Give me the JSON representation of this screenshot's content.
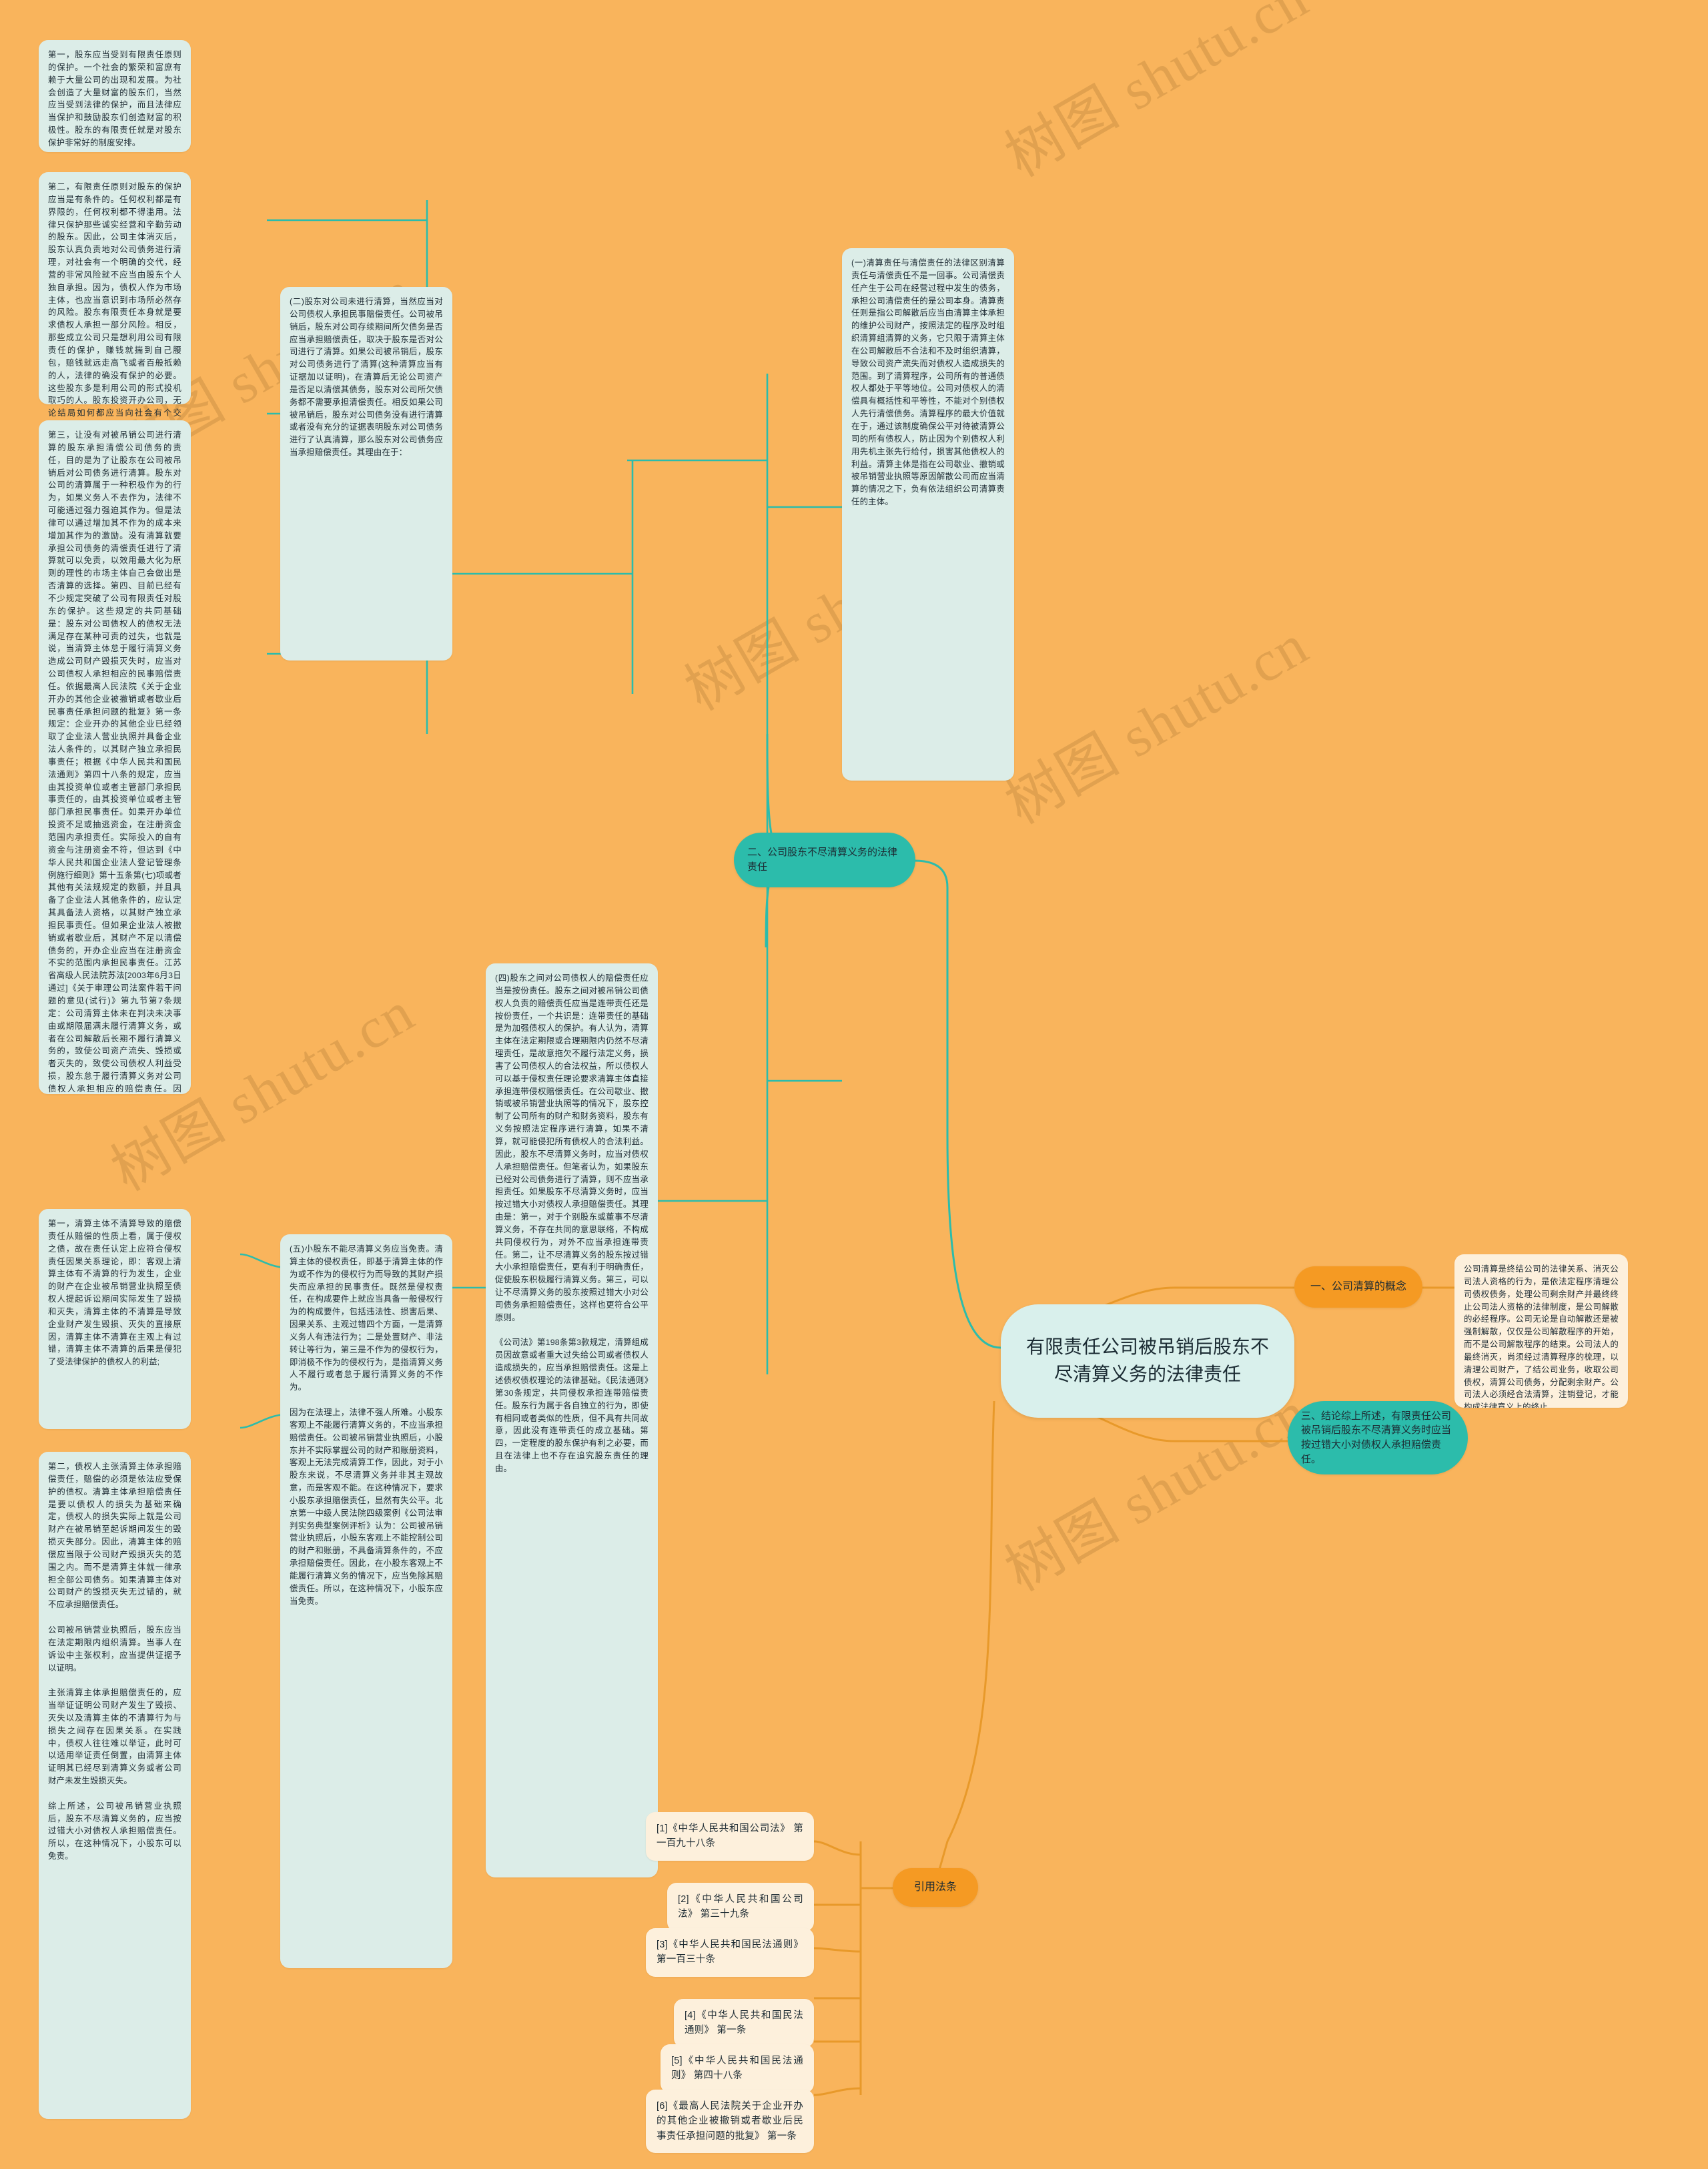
{
  "meta": {
    "background_color": "#F9B45C",
    "leaf_card_color": "#DCEDE8",
    "cream_card_color": "#FDF0DC",
    "teal_accent": "#2CBCAB",
    "orange_accent": "#F59A23",
    "root_color": "#D9F0EC"
  },
  "watermarks": [
    "树图 shutu.cn",
    "树图 shutu.cn",
    "树图 shutu.cn",
    "树图 shutu.cn",
    "树图 shutu.cn",
    "树图 shutu.cn"
  ],
  "root": {
    "title": "有限责任公司被吊销后股东不尽清算义务的法律责任"
  },
  "branches": {
    "concept": {
      "label": "一、公司清算的概念"
    },
    "liability": {
      "label": "二、公司股东不尽清算义务的法律责任"
    },
    "conclusion": {
      "label": "三、结论综上所述，有限责任公司被吊销后股东不尽清算义务时应当按过错大小对债权人承担赔偿责任。"
    },
    "references": {
      "label": "引用法条"
    }
  },
  "concept_detail": "公司清算是终结公司的法律关系、消灭公司法人资格的行为，是依法定程序清理公司债权债务，处理公司剩余财产并最终终止公司法人资格的法律制度，是公司解散的必经程序。公司无论是自动解散还是被强制解散，仅仅是公司解散程序的开始，而不是公司解散程序的结束。公司法人的最终消灭，尚须经过清算程序的梳理，以清理公司财产，了结公司业务，收取公司债权，清算公司债务，分配剩余财产。公司法人必须经合法清算，注销登记，才能构成法律意义上的终止。",
  "liability_sections": [
    {
      "id": "sec-yi",
      "text": "(一)清算责任与清偿责任的法律区别清算责任与清偿责任不是一回事。公司清偿责任产生于公司在经营过程中发生的债务，承担公司清偿责任的是公司本身。清算责任则是指公司解散后应当由清算主体承担的维护公司财产，按照法定的程序及时组织清算组清算的义务，它只限于清算主体在公司解散后不合法和不及时组织清算，导致公司资产流失而对债权人造成损失的范围。到了清算程序，公司所有的普通债权人都处于平等地位。公司对债权人的清偿具有概括性和平等性，不能对个别债权人先行清偿债务。清算程序的最大价值就在于，通过该制度确保公平对待被清算公司的所有债权人，防止因为个别债权人利用先机主张先行给付，损害其他债权人的利益。清算主体是指在公司歇业、撤销或被吊销营业执照等原因解散公司而应当清算的情况之下，负有依法组织公司清算责任的主体。"
    },
    {
      "id": "sec-er",
      "text": "(二)股东对公司未进行清算，当然应当对公司债权人承担民事赔偿责任。公司被吊销后，股东对公司存续期间所欠债务是否应当承担赔偿责任，取决于股东是否对公司进行了清算。如果公司被吊销后，股东对公司债务进行了清算(这种清算应当有证据加以证明)，在清算后无论公司资产是否足以清偿其债务，股东对公司所欠债务都不需要承担清偿责任。相反如果公司被吊销后，股东对公司债务没有进行清算或者没有充分的证据表明股东对公司债务进行了认真清算，那么股东对公司债务应当承担赔偿责任。其理由在于："
    },
    {
      "id": "sec-si",
      "text": "(四)股东之间对公司债权人的赔偿责任应当是按份责任。股东之间对被吊销公司债权人负责的赔偿责任应当是连带责任还是按份责任，一个共识是：连带责任的基础是为加强债权人的保护。有人认为，清算主体在法定期限或合理期限内仍然不尽清理责任，是故意拖欠不履行法定义务，损害了公司债权人的合法权益，所以债权人可以基于侵权责任理论要求清算主体直接承担连带侵权赔偿责任。在公司歇业、撤销或被吊销营业执照等的情况下，股东控制了公司所有的财产和财务资料，股东有义务按照法定程序进行清算，如果不清算，就可能侵犯所有债权人的合法利益。因此，股东不尽清算义务时，应当对债权人承担赔偿责任。但笔者认为，如果股东已经对公司债务进行了清算，则不应当承担责任。如果股东不尽清算义务时，应当按过错大小对债权人承担赔偿责任。其理由是：第一，对于个别股东或董事不尽清算义务，不存在共同的意思联络，不构成共同侵权行为，对外不应当承担连带责任。第二，让不尽清算义务的股东按过错大小承担赔偿责任，更有利于明确责任，促使股东积极履行清算义务。第三，可以让不尽清算义务的股东按照过错大小对公司债务承担赔偿责任，这样也更符合公平原则。\n\n《公司法》第198条第3款规定，清算组成员因故意或者重大过失给公司或者债权人造成损失的，应当承担赔偿责任。这是上述债权债权理论的法律基础。《民法通则》第30条规定，共同侵权承担连带赔偿责任。股东行为属于各自独立的行为，即使有相同或者类似的性质，但不具有共同故意，因此没有连带责任的成立基础。第四，一定程度的股东保护有利之必要，而且在法律上也不存在追究股东责任的理由。"
    },
    {
      "id": "sec-wu",
      "text": "(五)小股东不能尽清算义务应当免责。清算主体的侵权责任，即基于清算主体的作为或不作为的侵权行为而导致的其财产损失而应承担的民事责任。既然是侵权责任，在构成要件上就应当具备一般侵权行为的构成要件，包括违法性、损害后果、因果关系、主观过错四个方面，一是清算义务人有违法行为；二是处置财产、非法转让等行为，第三是不作为的侵权行为，即消极不作为的侵权行为，是指清算义务人不履行或者怠于履行清算义务的不作为。\n\n因为在法理上，法律不强人所难。小股东客观上不能履行清算义务的，不应当承担赔偿责任。公司被吊销营业执照后，小股东并不实际掌握公司的财产和账册资料，客观上无法完成清算工作，因此，对于小股东来说，不尽清算义务并非其主观故意，而是客观不能。在这种情况下，要求小股东承担赔偿责任，显然有失公平。北京第一中级人民法院四级案例《公司法审判实务典型案例评析》认为：公司被吊销营业执照后，小股东客观上不能控制公司的财产和账册，不具备清算条件的，不应承担赔偿责任。因此，在小股东客观上不能履行清算义务的情况下，应当免除其赔偿责任。所以，在这种情况下，小股东应当免责。"
    }
  ],
  "left_sections": [
    {
      "id": "left-1",
      "text": "第一，股东应当受到有限责任原则的保护。一个社会的繁荣和富庶有赖于大量公司的出现和发展。为社会创造了大量财富的股东们，当然应当受到法律的保护，而且法律应当保护和鼓励股东们创造财富的积极性。股东的有限责任就是对股东保护非常好的制度安排。"
    },
    {
      "id": "left-2",
      "text": "第二，有限责任原则对股东的保护应当是有条件的。任何权利都是有界限的，任何权利都不得滥用。法律只保护那些诚实经营和辛勤劳动的股东。因此，公司主体消灭后，股东认真负责地对公司债务进行清理，对社会有一个明确的交代，经营的非常风险就不应当由股东个人独自承担。因为，债权人作为市场主体，也应当意识到市场所必然存的风险。股东有限责任本身就是要求债权人承担一部分风险。相反，那些成立公司只是想利用公司有限责任的保护，赚钱就揣到自己腰包，赔钱就远走高飞或者百般抵赖的人，法律的确没有保护的必要。这些股东多是利用公司的形式投机取巧的人。股东投资开办公司，无论结局如何都应当向社会有个交代，更何况，还涉及到许多债权人的利益。因此股东对公司进行清算实际上是对债权人所负的义务。"
    },
    {
      "id": "left-3",
      "text": "第三，让没有对被吊销公司进行清算的股东承担清偿公司债务的责任，目的是为了让股东在公司被吊销后对公司债务进行清算。股东对公司的清算属于一种积极作为的行为，如果义务人不去作为，法律不可能通过强力强迫其作为。但是法律可以通过增加其不作为的成本来增加其作为的激励。没有清算就要承担公司债务的清偿责任进行了清算就可以免责，以效用最大化为原则的理性的市场主体自己会做出是否清算的选择。第四、目前已经有不少规定突破了公司有限责任对股东的保护。这些规定的共同基础是：股东对公司债权人的债权无法满足存在某种可责的过失，也就是说，当清算主体怠于履行清算义务造成公司财产毁损灭失时，应当对公司债权人承担相应的民事赔偿责任。依据最高人民法院《关于企业开办的其他企业被撤销或者歇业后民事责任承担问题的批复》第一条规定：企业开办的其他企业已经领取了企业法人营业执照并具备企业法人条件的，以其财产独立承担民事责任；根据《中华人民共和国民法通则》第四十八条的规定，应当由其投资单位或者主管部门承担民事责任的，由其投资单位或者主管部门承担民事责任。如果开办单位投资不足或抽逃资金，在注册资金范围内承担责任。实际投入的自有资金与注册资金不符，但达到《中华人民共和国企业法人登记管理条例施行细则》第十五条第(七)项或者其他有关法规规定的数额，并且具备了企业法人其他条件的，应认定其具备法人资格，以其财产独立承担民事责任。但如果企业法人被撤销或者歇业后，其财产不足以清偿债务的，开办企业应当在注册资金不实的范围内承担民事责任。江苏省高级人民法院苏法[2003年6月3日通过]《关于审理公司法案件若干问题的意见(试行)》第九节第7条规定：公司清算主体未在判决未决事由或期限届满未履行清算义务，或者在公司解散后长期不履行清算义务的，致使公司资产流失、毁损或者灭失的，致使公司债权人利益受损，股东怠于履行清算义务对公司债权人承担相应的赔偿责任。因此，股东对公司未进行清算，未尽到或应当注意义务，当然应当对公司债务承担赔偿责任。"
    },
    {
      "id": "left-4",
      "text": "第一，清算主体不清算导致的赔偿责任从赔偿的性质上看，属于侵权之债，故在责任认定上应符合侵权责任因果关系理论，即：客观上清算主体有不清算的行为发生，企业的财产在企业被吊销营业执照至债权人提起诉讼期间实际发生了毁损和灭失，清算主体的不清算是导致企业财产发生毁损、灭失的直接原因，清算主体不清算在主观上有过错，清算主体不清算的后果是侵犯了受法律保护的债权人的利益;"
    },
    {
      "id": "left-5",
      "text": "第二，债权人主张清算主体承担赔偿责任，赔偿的必须是依法应受保护的债权。清算主体承担赔偿责任是要以债权人的损失为基础来确定，债权人的损失实际上就是公司财产在被吊销至起诉期间发生的毁损灭失部分。因此，清算主体的赔偿应当限于公司财产毁损灭失的范围之内。而不是清算主体就一律承担全部公司债务。如果清算主体对公司财产的毁损灭失无过错的，就不应承担赔偿责任。\n\n公司被吊销营业执照后，股东应当在法定期限内组织清算。当事人在诉讼中主张权利，应当提供证据予以证明。\n\n主张清算主体承担赔偿责任的，应当举证证明公司财产发生了毁损、灭失以及清算主体的不清算行为与损失之间存在因果关系。在实践中，债权人往往难以举证，此时可以适用举证责任倒置，由清算主体证明其已经尽到清算义务或者公司财产未发生毁损灭失。\n\n综上所述，公司被吊销营业执照后，股东不尽清算义务的，应当按过错大小对债权人承担赔偿责任。所以，在这种情况下，小股东可以免责。"
    }
  ],
  "references": [
    "[1]《中华人民共和国公司法》 第一百九十八条",
    "[2]《中华人民共和国公司法》 第三十九条",
    "[3]《中华人民共和国民法通则》 第一百三十条",
    "[4]《中华人民共和国民法通则》 第一条",
    "[5]《中华人民共和国民法通则》 第四十八条",
    "[6]《最高人民法院关于企业开办的其他企业被撤销或者歇业后民事责任承担问题的批复》 第一条"
  ]
}
